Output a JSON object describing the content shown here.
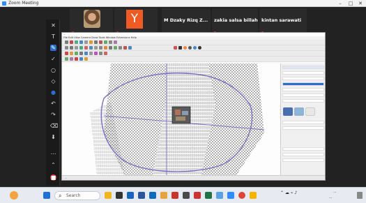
{
  "window": {
    "title": "Zoom Meeting",
    "min": "–",
    "max": "□",
    "close": "✕"
  },
  "participants": [
    {
      "name": "...",
      "muted": true
    },
    {
      "name": "...",
      "muted": true
    },
    {
      "name": "M Dzaky Rizq Z...",
      "sub": "...",
      "muted": false
    },
    {
      "name": "zakia salsa billah",
      "sub": "...",
      "muted": true
    },
    {
      "name": "kintan sarawati",
      "sub": "...",
      "muted": true
    }
  ],
  "avatar_letter": "Y",
  "sketchup": {
    "title": "...",
    "menu": "File  Edit  View  Camera  Draw  Tools  Window  Extensions  Help",
    "status": "..."
  },
  "taskbar": {
    "search_placeholder": "Search",
    "time": "...",
    "date": "..."
  },
  "colors": {
    "accent": "#2d6dcc",
    "zoom_orange": "#f05a24",
    "record_red": "#d33"
  }
}
